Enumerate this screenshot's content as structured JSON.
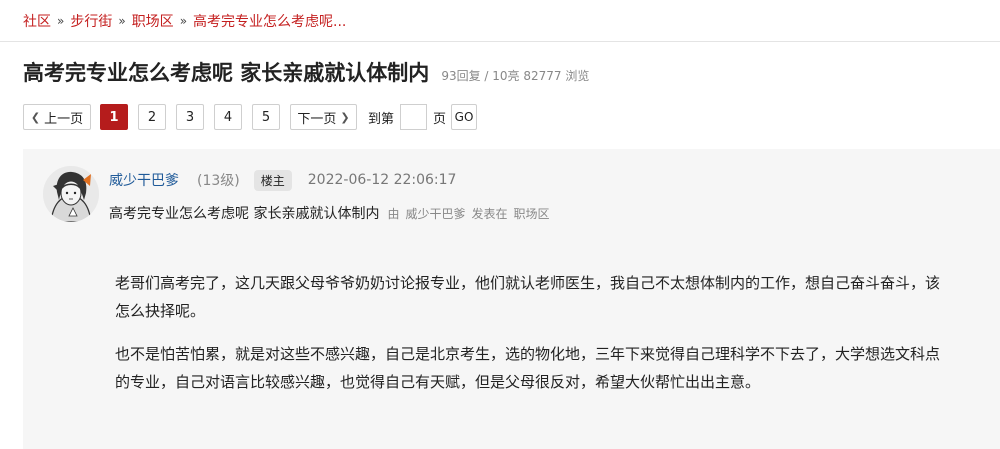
{
  "breadcrumb": {
    "items": [
      "社区",
      "步行街",
      "职场区",
      "高考完专业怎么考虑呢..."
    ],
    "separator": "»"
  },
  "thread": {
    "title": "高考完专业怎么考虑呢 家长亲戚就认体制内",
    "stats": "93回复 / 10亮 82777 浏览"
  },
  "pagination": {
    "prev_label": "上一页",
    "next_label": "下一页",
    "pages": [
      "1",
      "2",
      "3",
      "4",
      "5"
    ],
    "current_page": "1",
    "goto_prefix": "到第",
    "goto_suffix": "页",
    "goto_input_value": "",
    "go_label": "GO"
  },
  "post": {
    "author": "威少干巴爹",
    "level": "(13级)",
    "badge": "楼主",
    "time": "2022-06-12 22:06:17",
    "subtitle": "高考完专业怎么考虑呢 家长亲戚就认体制内",
    "meta_by": "由",
    "meta_author": "威少干巴爹",
    "meta_posted_in": "发表在",
    "meta_board": "职场区",
    "paragraphs": [
      "老哥们高考完了，这几天跟父母爷爷奶奶讨论报专业，他们就认老师医生，我自己不太想体制内的工作，想自己奋斗奋斗，该怎么抉择呢。",
      "也不是怕苦怕累，就是对这些不感兴趣，自己是北京考生，选的物化地，三年下来觉得自己理科学不下去了，大学想选文科点的专业，自己对语言比较感兴趣，也觉得自己有天赋，但是父母很反对，希望大伙帮忙出出主意。"
    ]
  },
  "colors": {
    "accent": "#b51c1c",
    "link": "#1f5a99",
    "post_bg": "#f6f6f6"
  },
  "icons": {
    "breadcrumb_separator": "double-chevron-right-icon",
    "prev": "chevron-left-icon",
    "next": "chevron-right-icon",
    "avatar": "user-avatar-icon"
  }
}
